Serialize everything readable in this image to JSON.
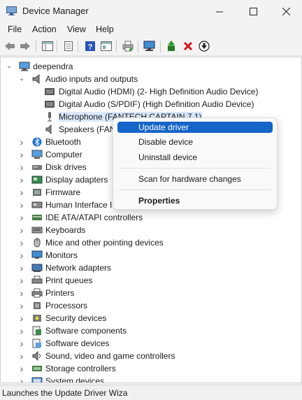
{
  "window": {
    "title": "Device Manager"
  },
  "menu": {
    "file": "File",
    "action": "Action",
    "view": "View",
    "help": "Help"
  },
  "tree": {
    "root": "deependra",
    "audio": {
      "label": "Audio inputs and outputs",
      "children": [
        "Digital Audio (HDMI) (2- High Definition Audio Device)",
        "Digital Audio (S/PDIF) (High Definition Audio Device)",
        "Microphone (FANTECH CAPTAIN 7.1)",
        "Speakers (FAN"
      ]
    },
    "categories": [
      "Bluetooth",
      "Computer",
      "Disk drives",
      "Display adapters",
      "Firmware",
      "Human Interface I",
      "IDE ATA/ATAPI controllers",
      "Keyboards",
      "Mice and other pointing devices",
      "Monitors",
      "Network adapters",
      "Print queues",
      "Printers",
      "Processors",
      "Security devices",
      "Software components",
      "Software devices",
      "Sound, video and game controllers",
      "Storage controllers",
      "System devices"
    ]
  },
  "context_menu": {
    "update_driver": "Update driver",
    "disable_device": "Disable device",
    "uninstall_device": "Uninstall device",
    "scan": "Scan for hardware changes",
    "properties": "Properties"
  },
  "status": {
    "text": "Launches the Update Driver Wizard for t"
  }
}
